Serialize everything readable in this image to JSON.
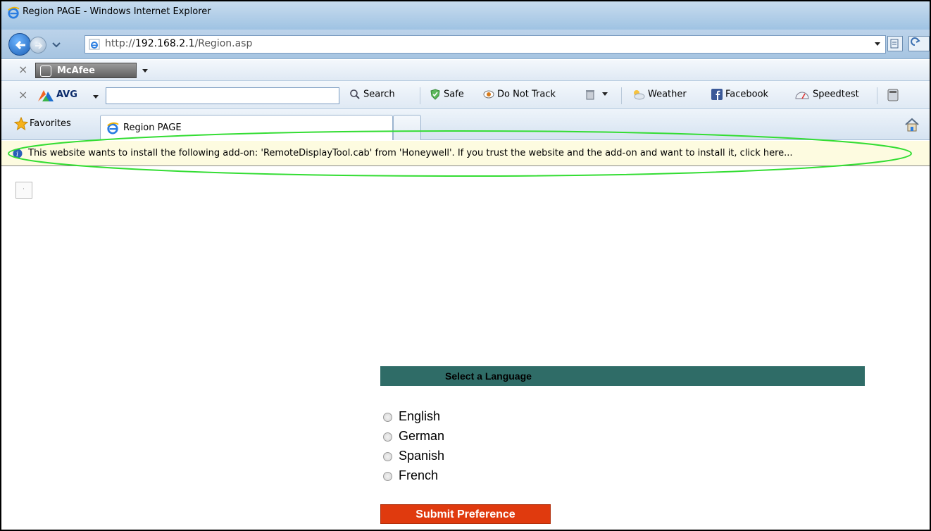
{
  "window": {
    "title": "Region PAGE - Windows Internet Explorer"
  },
  "address_bar": {
    "url_prefix": "http://",
    "url_host": "192.168.2.1",
    "url_path": "/Region.asp"
  },
  "mcafee_toolbar": {
    "label": "McAfee"
  },
  "avg_toolbar": {
    "label": "AVG",
    "search_value": "",
    "items": {
      "search": "Search",
      "safe": "Safe",
      "do_not_track": "Do Not Track",
      "weather": "Weather",
      "facebook": "Facebook",
      "speedtest": "Speedtest"
    }
  },
  "favorites_bar": {
    "favorites_label": "Favorites",
    "tab_label": "Region PAGE"
  },
  "info_bar": {
    "text": "This website wants to install the following add-on: 'RemoteDisplayTool.cab' from 'Honeywell'. If you trust the website and the add-on and want to install it, click here..."
  },
  "page": {
    "language_header": "Select a Language",
    "languages": [
      "English",
      "German",
      "Spanish",
      "French"
    ],
    "submit_label": "Submit Preference"
  },
  "colors": {
    "header_bg": "#2f6c67",
    "submit_bg": "#e03a0e",
    "highlight": "#33dd33",
    "info_bar_bg": "#fdfbe0"
  }
}
